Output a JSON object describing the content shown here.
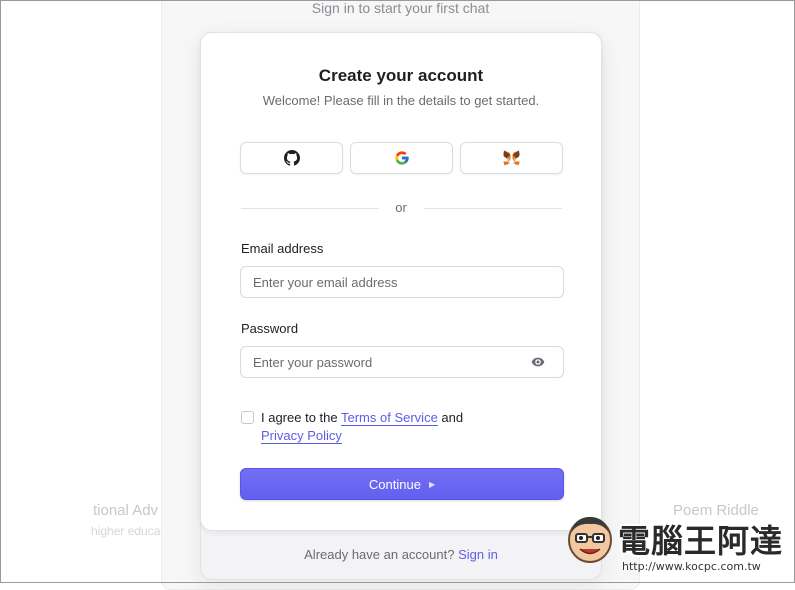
{
  "background": {
    "subtitle": "Sign in to start your first chat",
    "card_left": {
      "title": "tional Adv",
      "sub": "higher educa"
    },
    "card_right": {
      "title": "Poem Riddle",
      "sub": ""
    }
  },
  "modal": {
    "title": "Create your account",
    "subtitle": "Welcome! Please fill in the details to get started.",
    "social": [
      {
        "provider": "GitHub",
        "icon": "github-icon"
      },
      {
        "provider": "Google",
        "icon": "google-icon"
      },
      {
        "provider": "MetaMask",
        "icon": "metamask-icon"
      }
    ],
    "divider_text": "or",
    "email": {
      "label": "Email address",
      "placeholder": "Enter your email address",
      "value": ""
    },
    "password": {
      "label": "Password",
      "placeholder": "Enter your password",
      "value": ""
    },
    "agree": {
      "prefix": "I agree to the ",
      "terms": "Terms of Service",
      "middle": " and ",
      "privacy": "Privacy Policy",
      "checked": false
    },
    "continue_label": "Continue",
    "footer": {
      "text": "Already have an account?",
      "link": "Sign in"
    }
  },
  "watermark": {
    "text": "電腦王阿達",
    "url": "http://www.kocpc.com.tw"
  },
  "colors": {
    "accent": "#6460f0",
    "link": "#5e5ce6"
  }
}
